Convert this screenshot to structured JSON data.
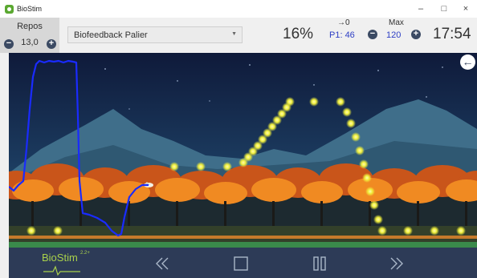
{
  "app": {
    "title": "BioStim"
  },
  "window_controls": {
    "minimize": "–",
    "maximize": "□",
    "close": "×"
  },
  "toolbar": {
    "repos_label": "Repos",
    "repos_value": "13,0",
    "mode_selected": "Biofeedback Palier",
    "percent": "16%",
    "arrow_value": "→0",
    "p1_value": "P1: 46",
    "max_label": "Max",
    "max_value": "120",
    "clock": "17:54"
  },
  "bottom": {
    "logo_text": "BioStim",
    "logo_sup": "2.2+"
  },
  "icons": {
    "repos_minus": "minus-circle-icon",
    "repos_plus": "plus-circle-icon",
    "max_minus": "minus-circle-icon",
    "max_plus": "plus-circle-icon",
    "back": "arrow-left-icon",
    "rewind": "rewind-icon",
    "stop": "stop-icon",
    "pause": "pause-icon",
    "fast_forward": "fast-forward-icon"
  },
  "colors": {
    "sky_top": "#0f1a3a",
    "sky_bottom": "#1f5673",
    "mountains": "#3f6e8a",
    "trees": "#e8761b",
    "ground": "#33402a",
    "emg_line": "#1a2bff",
    "targets": "#f0ef3c",
    "accent_blue": "#2d3ec4",
    "bottom_bar": "#2d3b57",
    "logo_green": "#a9d14b"
  }
}
